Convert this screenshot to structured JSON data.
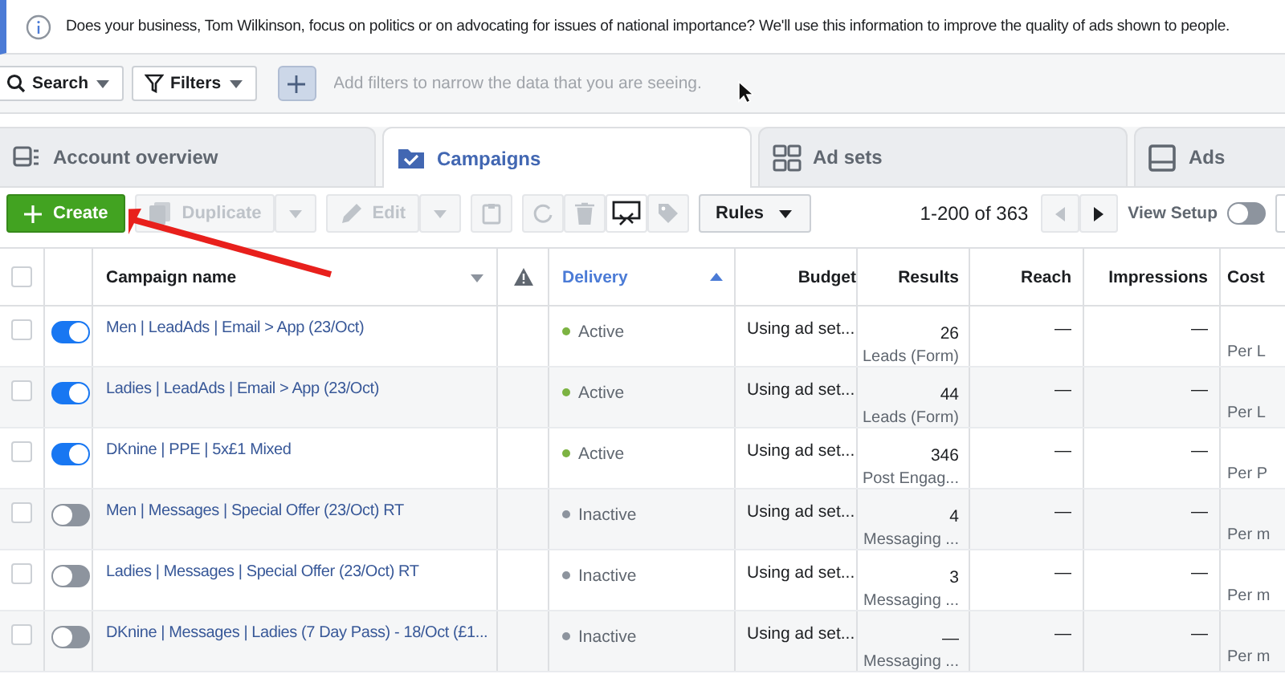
{
  "banner": {
    "text": "Does your business, Tom Wilkinson, focus on politics or on advocating for issues of national importance? We'll use this information to improve the quality of ads shown to people."
  },
  "filter_bar": {
    "search_label": "Search",
    "filters_label": "Filters",
    "placeholder": "Add filters to narrow the data that you are seeing."
  },
  "tabs": [
    {
      "label": "Account overview",
      "selected": false
    },
    {
      "label": "Campaigns",
      "selected": true
    },
    {
      "label": "Ad sets",
      "selected": false
    },
    {
      "label": "Ads",
      "selected": false
    }
  ],
  "toolbar": {
    "create": "Create",
    "duplicate": {
      "label": "Duplicate",
      "disabled": true
    },
    "edit": {
      "label": "Edit",
      "disabled": true
    },
    "rules": "Rules",
    "pagination": "1-200 of 363",
    "view_setup": {
      "label": "View Setup",
      "on": false
    }
  },
  "table": {
    "all_checked": false,
    "columns": [
      {
        "label": "Campaign name",
        "sorted": false
      },
      {
        "label": "Delivery",
        "sorted": true
      },
      {
        "label": "Budget",
        "sorted": false
      },
      {
        "label": "Results",
        "sorted": false
      },
      {
        "label": "Reach",
        "sorted": false
      },
      {
        "label": "Impressions",
        "sorted": false
      },
      {
        "label": "Cost",
        "sorted": false
      }
    ],
    "rows": [
      {
        "checked": false,
        "on": true,
        "name": "Men | LeadAds | Email > App (23/Oct)",
        "delivery": "Active",
        "color": "#7cb342",
        "budget": "Using ad set...",
        "result": "26",
        "result_type": "Leads (Form)",
        "reach": "—",
        "impressions": "—",
        "cost_type": "Per L"
      },
      {
        "checked": false,
        "on": true,
        "name": "Ladies | LeadAds | Email > App (23/Oct)",
        "delivery": "Active",
        "color": "#7cb342",
        "budget": "Using ad set...",
        "result": "44",
        "result_type": "Leads (Form)",
        "reach": "—",
        "impressions": "—",
        "cost_type": "Per L"
      },
      {
        "checked": false,
        "on": true,
        "name": "DKnine | PPE | 5x£1 Mixed",
        "delivery": "Active",
        "color": "#7cb342",
        "budget": "Using ad set...",
        "result": "346",
        "result_type": "Post Engag...",
        "reach": "—",
        "impressions": "—",
        "cost_type": "Per P"
      },
      {
        "checked": false,
        "on": false,
        "name": "Men | Messages | Special Offer (23/Oct) RT",
        "delivery": "Inactive",
        "color": "#8d949e",
        "budget": "Using ad set...",
        "result": "4",
        "result_type": "Messaging ...",
        "reach": "—",
        "impressions": "—",
        "cost_type": "Per m"
      },
      {
        "checked": false,
        "on": false,
        "name": "Ladies | Messages | Special Offer (23/Oct) RT",
        "delivery": "Inactive",
        "color": "#8d949e",
        "budget": "Using ad set...",
        "result": "3",
        "result_type": "Messaging ...",
        "reach": "—",
        "impressions": "—",
        "cost_type": "Per m"
      },
      {
        "checked": false,
        "on": false,
        "name": "DKnine | Messages | Ladies (7 Day Pass) - 18/Oct (£1...",
        "delivery": "Inactive",
        "color": "#8d949e",
        "budget": "Using ad set...",
        "result": "—",
        "result_type": "Messaging ...",
        "reach": "—",
        "impressions": "—",
        "cost_type": "Per m"
      }
    ]
  }
}
